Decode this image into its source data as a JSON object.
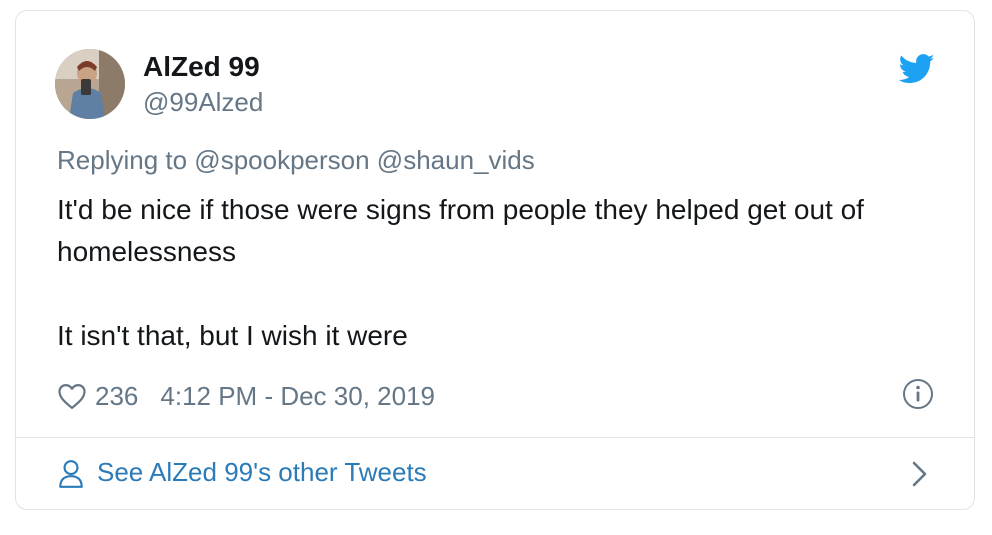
{
  "author": {
    "display_name": "AlZed 99",
    "handle": "@99Alzed"
  },
  "reply": {
    "text": "Replying to @spookperson @shaun_vids"
  },
  "tweet": {
    "paragraph_1": "It'd be nice if those were signs from people they helped get out of homelessness",
    "paragraph_2": "It isn't that, but I wish it were"
  },
  "meta": {
    "likes": "236",
    "timestamp": "4:12 PM - Dec 30, 2019"
  },
  "footer": {
    "link_text": "See AlZed 99's other Tweets"
  },
  "colors": {
    "twitter_blue": "#1da1f2",
    "link_blue": "#2b7bb9",
    "secondary_text": "#657786",
    "primary_text": "#14171a"
  },
  "icons": {
    "brand": "twitter-bird-icon",
    "like": "heart-icon",
    "info": "info-icon",
    "profile": "person-icon",
    "chevron": "chevron-right-icon"
  }
}
